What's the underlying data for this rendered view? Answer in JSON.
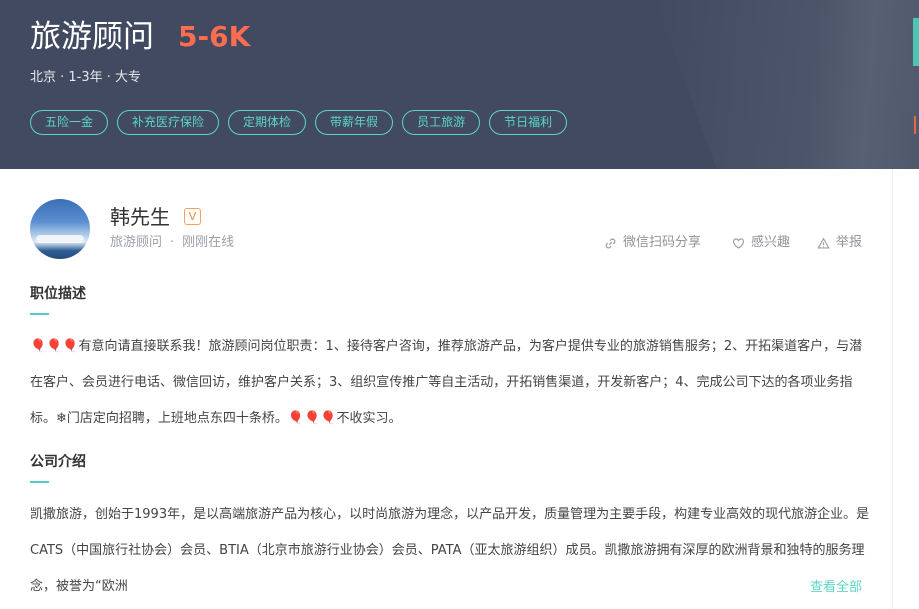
{
  "job": {
    "title": "旅游顾问",
    "salary": "5-6K",
    "meta": "北京 · 1-3年 · 大专",
    "tags": [
      "五险一金",
      "补充医疗保险",
      "定期体检",
      "带薪年假",
      "员工旅游",
      "节日福利"
    ]
  },
  "boss": {
    "name": "韩先生",
    "badge": "V",
    "position": "旅游顾问",
    "separator": "·",
    "status": "刚刚在线"
  },
  "actions": {
    "share": "微信扫码分享",
    "interest": "感兴趣",
    "report": "举报"
  },
  "sections": {
    "job_desc_title": "职位描述",
    "job_desc": "🎈🎈🎈有意向请直接联系我！旅游顾问岗位职责：1、接待客户咨询，推荐旅游产品，为客户提供专业的旅游销售服务；2、开拓渠道客户，与潜在客户、会员进行电话、微信回访，维护客户关系；3、组织宣传推广等自主活动，开拓销售渠道，开发新客户；4、完成公司下达的各项业务指标。❄门店定向招聘，上班地点东四十条桥。🎈🎈🎈不收实习。",
    "company_title": "公司介绍",
    "company_desc": "凯撒旅游，创始于1993年，是以高端旅游产品为核心，以时尚旅游为理念，以产品开发，质量管理为主要手段，构建专业高效的现代旅游企业。是CATS（中国旅行社协会）会员、BTIA（北京市旅游行业协会）会员、PATA（亚太旅游组织）成员。凯撒旅游拥有深厚的欧洲背景和独特的服务理念，被誉为“欧洲",
    "view_all": "查看全部"
  },
  "colors": {
    "header_bg": "#414a60",
    "salary": "#fe6d4f",
    "accent": "#5dd5c8"
  }
}
